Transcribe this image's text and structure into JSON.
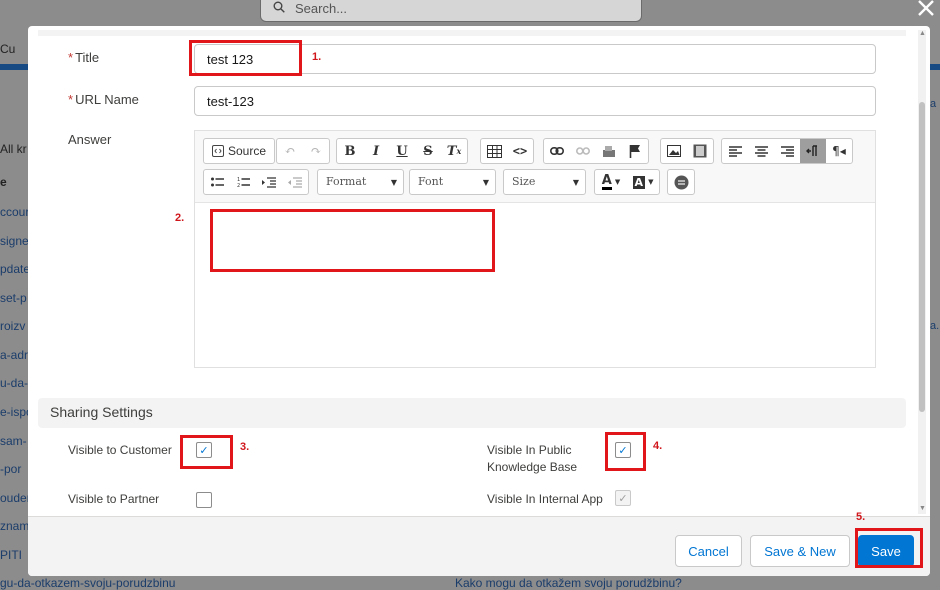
{
  "background": {
    "search_placeholder": "Search...",
    "left_fragments": [
      "Cu",
      "All kr",
      "e",
      "ccour",
      "signe",
      "pdate",
      "set-p",
      "roizv",
      "a-adr",
      "u-da-",
      "e-ispo",
      "sam-",
      "-por",
      "ouder",
      "znam",
      "PITI"
    ],
    "bottom_left_link": "gu-da-otkazem-svoju-porudzbinu",
    "bottom_right_link": "Kako mogu da otkažem svoju porudžbinu?",
    "right_fragments": [
      "a",
      "a."
    ]
  },
  "form": {
    "title_label": "Title",
    "title_value": "test 123",
    "url_label": "URL Name",
    "url_value": "test-123",
    "answer_label": "Answer"
  },
  "editor": {
    "source_label": "Source",
    "format_label": "Format",
    "font_label": "Font",
    "size_label": "Size"
  },
  "sharing": {
    "heading": "Sharing Settings",
    "visible_customer_label": "Visible to Customer",
    "visible_customer_checked": true,
    "visible_partner_label": "Visible to Partner",
    "visible_partner_checked": false,
    "visible_public_kb_label_1": "Visible In Public",
    "visible_public_kb_label_2": "Knowledge Base",
    "visible_public_kb_checked": true,
    "visible_internal_label": "Visible In Internal App",
    "visible_internal_checked": true
  },
  "footer": {
    "cancel_label": "Cancel",
    "save_new_label": "Save & New",
    "save_label": "Save"
  },
  "annotations": [
    "1.",
    "2.",
    "3.",
    "4.",
    "5."
  ],
  "colors": {
    "brand": "#0176d3",
    "annotation": "#e1161b",
    "required": "#c23934"
  }
}
